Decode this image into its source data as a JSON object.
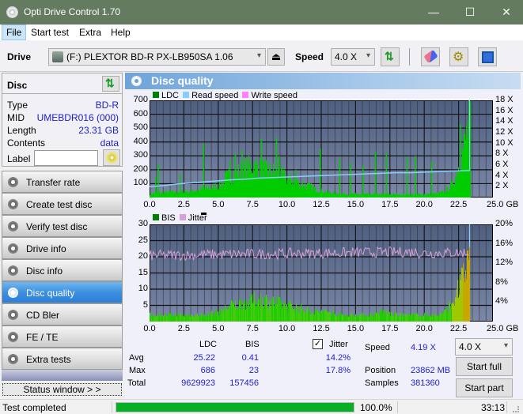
{
  "window": {
    "title": "Opti Drive Control 1.70",
    "minimize": "—",
    "maximize": "☐",
    "close": "✕"
  },
  "menu": [
    {
      "label": "File",
      "u": "F"
    },
    {
      "label": "Start test",
      "u": "S"
    },
    {
      "label": "Extra",
      "u": "x"
    },
    {
      "label": "Help",
      "u": "H"
    }
  ],
  "toolbar": {
    "drive_label": "Drive",
    "drive_value": "(F:)  PLEXTOR BD-R  PX-LB950SA 1.06",
    "speed_label": "Speed",
    "speed_value": "4.0 X",
    "icons": [
      "drive-icon",
      "eject-icon",
      "refresh-icon",
      "erase-icon",
      "settings-icon",
      "save-icon"
    ]
  },
  "disc": {
    "header": "Disc",
    "rows": [
      {
        "label": "Type",
        "value": "BD-R"
      },
      {
        "label": "MID",
        "value": "UMEBDR016 (000)"
      },
      {
        "label": "Length",
        "value": "23.31 GB"
      },
      {
        "label": "Contents",
        "value": "data"
      }
    ],
    "label_field": {
      "label": "Label",
      "value": ""
    }
  },
  "nav": [
    {
      "label": "Transfer rate",
      "selected": false
    },
    {
      "label": "Create test disc",
      "selected": false
    },
    {
      "label": "Verify test disc",
      "selected": false
    },
    {
      "label": "Drive info",
      "selected": false
    },
    {
      "label": "Disc info",
      "selected": false
    },
    {
      "label": "Disc quality",
      "selected": true
    },
    {
      "label": "CD Bler",
      "selected": false
    },
    {
      "label": "FE / TE",
      "selected": false
    },
    {
      "label": "Extra tests",
      "selected": false
    }
  ],
  "status_window_btn": "Status window > >",
  "panel_title": "Disc quality",
  "colors": {
    "ldc": "#008000",
    "read_speed": "#87cefa",
    "write_speed": "#ff80ff",
    "bis": "#008000",
    "jitter": "#d8a0d8",
    "bars": "#00cc00",
    "plot_bg_top": "#4e5f80",
    "plot_bg_bottom": "#7b88a8"
  },
  "chart_data": [
    {
      "type": "bar",
      "title": "LDC / Read speed",
      "legend": [
        "LDC",
        "Read speed",
        "Write speed"
      ],
      "x_ticks": [
        "0.0",
        "2.5",
        "5.0",
        "7.5",
        "10.0",
        "12.5",
        "15.0",
        "17.5",
        "20.0",
        "22.5",
        "25.0 GB"
      ],
      "xlim": [
        0,
        25
      ],
      "y_ticks": [
        "100",
        "200",
        "300",
        "400",
        "500",
        "600",
        "700"
      ],
      "ylim": [
        0,
        700
      ],
      "y2_ticks": [
        "2 X",
        "4 X",
        "6 X",
        "8 X",
        "10 X",
        "12 X",
        "14 X",
        "16 X",
        "18 X"
      ],
      "y2lim": [
        0,
        18
      ],
      "ldc_profile": [
        [
          0,
          30
        ],
        [
          1,
          40
        ],
        [
          2,
          45
        ],
        [
          3,
          50
        ],
        [
          4,
          70
        ],
        [
          5,
          90
        ],
        [
          5.5,
          150
        ],
        [
          6,
          180
        ],
        [
          6.5,
          200
        ],
        [
          7,
          230
        ],
        [
          7.5,
          250
        ],
        [
          8,
          230
        ],
        [
          8.5,
          210
        ],
        [
          9,
          200
        ],
        [
          9.5,
          180
        ],
        [
          10,
          150
        ],
        [
          10.5,
          130
        ],
        [
          11,
          110
        ],
        [
          11.5,
          90
        ],
        [
          12,
          70
        ],
        [
          12.5,
          50
        ],
        [
          13,
          40
        ],
        [
          14,
          30
        ],
        [
          15,
          25
        ],
        [
          16,
          25
        ],
        [
          17,
          25
        ],
        [
          18,
          25
        ],
        [
          19,
          25
        ],
        [
          20,
          25
        ],
        [
          21,
          30
        ],
        [
          21.5,
          50
        ],
        [
          22,
          100
        ],
        [
          22.5,
          250
        ],
        [
          23,
          450
        ],
        [
          23.3,
          650
        ]
      ],
      "ldc_spikes": [
        [
          0.4,
          150
        ],
        [
          0.6,
          240
        ],
        [
          2.2,
          170
        ],
        [
          3.9,
          390
        ],
        [
          5.8,
          270
        ],
        [
          6.2,
          320
        ],
        [
          6.7,
          340
        ],
        [
          8.1,
          430
        ],
        [
          9.2,
          430
        ],
        [
          9.4,
          300
        ],
        [
          10.6,
          200
        ],
        [
          12.4,
          350
        ],
        [
          13.8,
          280
        ],
        [
          14.6,
          250
        ],
        [
          15.5,
          230
        ],
        [
          16.4,
          330
        ],
        [
          17.2,
          320
        ],
        [
          18.7,
          290
        ],
        [
          19.3,
          300
        ],
        [
          20.5,
          260
        ],
        [
          22.6,
          530
        ],
        [
          23.3,
          686
        ]
      ],
      "read_speed": [
        [
          0,
          2.0
        ],
        [
          1,
          2.2
        ],
        [
          2,
          2.5
        ],
        [
          3,
          2.7
        ],
        [
          4,
          2.9
        ],
        [
          5,
          3.1
        ],
        [
          6,
          3.3
        ],
        [
          7,
          3.4
        ],
        [
          8,
          3.6
        ],
        [
          9,
          3.7
        ],
        [
          10,
          3.8
        ],
        [
          11,
          3.9
        ],
        [
          12,
          4.0
        ],
        [
          13,
          4.1
        ],
        [
          14,
          4.2
        ],
        [
          15,
          4.3
        ],
        [
          16,
          4.4
        ],
        [
          17,
          4.5
        ],
        [
          18,
          4.6
        ],
        [
          19,
          4.6
        ],
        [
          20,
          4.7
        ],
        [
          21,
          4.8
        ],
        [
          22,
          4.9
        ],
        [
          23.3,
          5.0
        ]
      ]
    },
    {
      "type": "bar",
      "title": "BIS / Jitter",
      "legend": [
        "BIS",
        "Jitter"
      ],
      "x_ticks": [
        "0.0",
        "2.5",
        "5.0",
        "7.5",
        "10.0",
        "12.5",
        "15.0",
        "17.5",
        "20.0",
        "22.5",
        "25.0 GB"
      ],
      "xlim": [
        0,
        25
      ],
      "y_ticks": [
        "5",
        "10",
        "15",
        "20",
        "25",
        "30"
      ],
      "ylim": [
        0,
        30
      ],
      "y2_ticks": [
        "4%",
        "8%",
        "12%",
        "16%",
        "20%"
      ],
      "y2lim": [
        0,
        20
      ],
      "bis_profile": [
        [
          0,
          2
        ],
        [
          2,
          2
        ],
        [
          4,
          2
        ],
        [
          5,
          3
        ],
        [
          5.5,
          4
        ],
        [
          6,
          5
        ],
        [
          7,
          6
        ],
        [
          8,
          7
        ],
        [
          9,
          6
        ],
        [
          10,
          5
        ],
        [
          11,
          4
        ],
        [
          12,
          3
        ],
        [
          13,
          3
        ],
        [
          14,
          2
        ],
        [
          16,
          2
        ],
        [
          17,
          3
        ],
        [
          18,
          2
        ],
        [
          20,
          2
        ],
        [
          21,
          2
        ],
        [
          21.5,
          3
        ],
        [
          22,
          6
        ],
        [
          22.5,
          10
        ],
        [
          23,
          16
        ],
        [
          23.3,
          23
        ]
      ],
      "jitter_avg_pct": 14.2,
      "jitter_max_pct": 17.8
    }
  ],
  "stats": {
    "headers": [
      "LDC",
      "BIS"
    ],
    "jitter_label": "Jitter",
    "jitter_checked": true,
    "rows": [
      {
        "label": "Avg",
        "ldc": "25.22",
        "bis": "0.41",
        "jitter": "14.2%"
      },
      {
        "label": "Max",
        "ldc": "686",
        "bis": "23",
        "jitter": "17.8%"
      },
      {
        "label": "Total",
        "ldc": "9629923",
        "bis": "157456",
        "jitter": ""
      }
    ],
    "speed_label": "Speed",
    "speed_value": "4.19 X",
    "position_label": "Position",
    "position_value": "23862 MB",
    "samples_label": "Samples",
    "samples_value": "381360",
    "speed_select": "4.0 X",
    "start_full": "Start full",
    "start_part": "Start part"
  },
  "statusbar": {
    "text": "Test completed",
    "progress": 100.0,
    "progress_label": "100.0%",
    "time": "33:13"
  }
}
